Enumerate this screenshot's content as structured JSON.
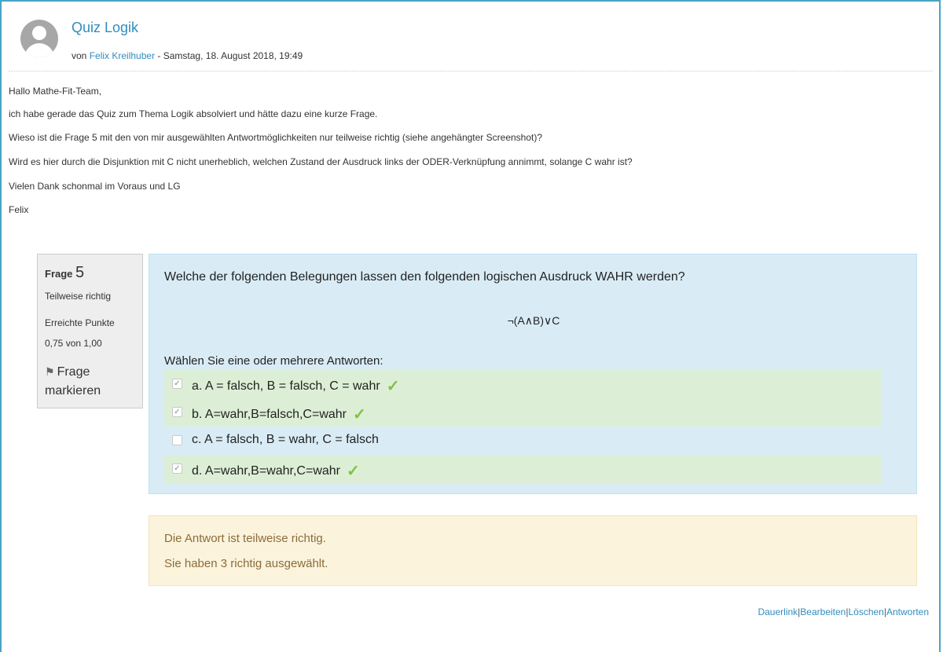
{
  "post": {
    "title": "Quiz Logik",
    "by_prefix": "von",
    "author": "Felix Kreilhuber",
    "date": "- Samstag, 18. August 2018, 19:49",
    "lines": [
      "Hallo Mathe-Fit-Team,",
      "ich habe gerade das Quiz zum Thema Logik absolviert und hätte dazu eine kurze Frage.",
      "Wieso ist die Frage 5 mit den von mir ausgewählten Antwortmöglichkeiten nur teilweise richtig (siehe angehängter Screenshot)?",
      "Wird es hier durch die Disjunktion mit C nicht unerheblich, welchen Zustand der Ausdruck links der ODER-Verknüpfung annimmt, solange C wahr ist?",
      "Vielen Dank schonmal im Voraus und LG",
      "Felix"
    ]
  },
  "question_info": {
    "label": "Frage",
    "number": "5",
    "status": "Teilweise richtig",
    "points_label": "Erreichte Punkte",
    "points": "0,75 von 1,00",
    "flag_label_1": "Frage",
    "flag_label_2": "markieren",
    "flag_icon": "flag-icon"
  },
  "question": {
    "text": "Welche der folgenden Belegungen lassen den folgenden logischen Ausdruck WAHR werden?",
    "expression": "¬(A∧B)∨C",
    "prompt": "Wählen Sie eine oder mehrere Antworten:",
    "answers": [
      {
        "label": "a. A = falsch, B = falsch, C = wahr",
        "checked": true,
        "correct": true
      },
      {
        "label": "b. A=wahr,B=falsch,C=wahr",
        "checked": true,
        "correct": true
      },
      {
        "label": "c. A = falsch, B = wahr, C = falsch",
        "checked": false,
        "correct": false
      },
      {
        "label": "d. A=wahr,B=wahr,C=wahr",
        "checked": true,
        "correct": true
      }
    ]
  },
  "feedback": {
    "line1": "Die Antwort ist teilweise richtig.",
    "line2": "Sie haben 3 richtig ausgewählt."
  },
  "links": {
    "permalink": "Dauerlink",
    "edit": "Bearbeiten",
    "delete": "Löschen",
    "reply": "Antworten",
    "sep": "|"
  },
  "colors": {
    "accent": "#2f8dbf",
    "question_bg": "#d9ecf6",
    "correct_bg": "#dcefd6",
    "feedback_bg": "#fcf3dd",
    "tick": "#7dc242"
  }
}
